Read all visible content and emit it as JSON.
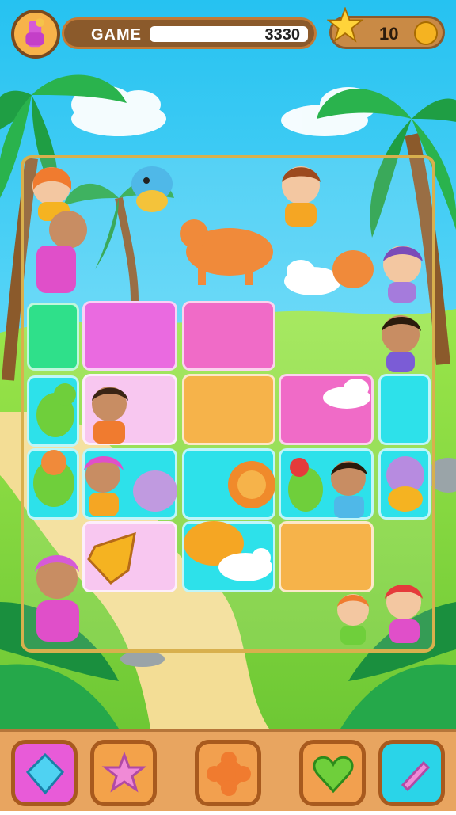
{
  "hud": {
    "score_label": "GAME",
    "score_value": "3330",
    "coins": "10"
  },
  "colors": {
    "sky": "#2bc7f2",
    "grass": "#8fd33f",
    "sand": "#f0d58a",
    "board_frame": "#d8b04d",
    "tile_green": "#2fe08a",
    "tile_magenta": "#ea6ae0",
    "tile_pink": "#f06bc7",
    "tile_light_pink": "#f8c7f0",
    "tile_orange": "#f6b34a",
    "tile_cyan": "#2de1ea"
  },
  "board": {
    "tiles": [
      {
        "color": "tile_green",
        "content": ""
      },
      {
        "color": "tile_magenta",
        "content": ""
      },
      {
        "color": "tile_pink",
        "content": ""
      },
      {
        "color": "tile_light_pink",
        "content": "kid-waving"
      },
      {
        "color": "tile_orange",
        "content": ""
      },
      {
        "color": "tile_pink",
        "content": "cloud"
      },
      {
        "color": "tile_cyan",
        "content": ""
      },
      {
        "color": "tile_cyan",
        "content": "green-dino"
      },
      {
        "color": "tile_light_pink",
        "content": "kid-turban"
      },
      {
        "color": "tile_cyan",
        "content": "lion"
      },
      {
        "color": "tile_cyan",
        "content": "kid-boy"
      },
      {
        "color": "tile_light_pink",
        "content": "bow"
      },
      {
        "color": "tile_cyan",
        "content": "dog-cloud"
      },
      {
        "color": "tile_orange",
        "content": ""
      }
    ]
  },
  "powerups": [
    {
      "name": "gem-icon",
      "color": "#e85bd8"
    },
    {
      "name": "star-icon",
      "color": "#f3a24a"
    },
    {
      "name": "flower-icon",
      "color": "#f2a04f"
    },
    {
      "name": "heart-icon",
      "color": "#f2a04f"
    },
    {
      "name": "crystal-icon",
      "color": "#2ad4e8"
    }
  ]
}
